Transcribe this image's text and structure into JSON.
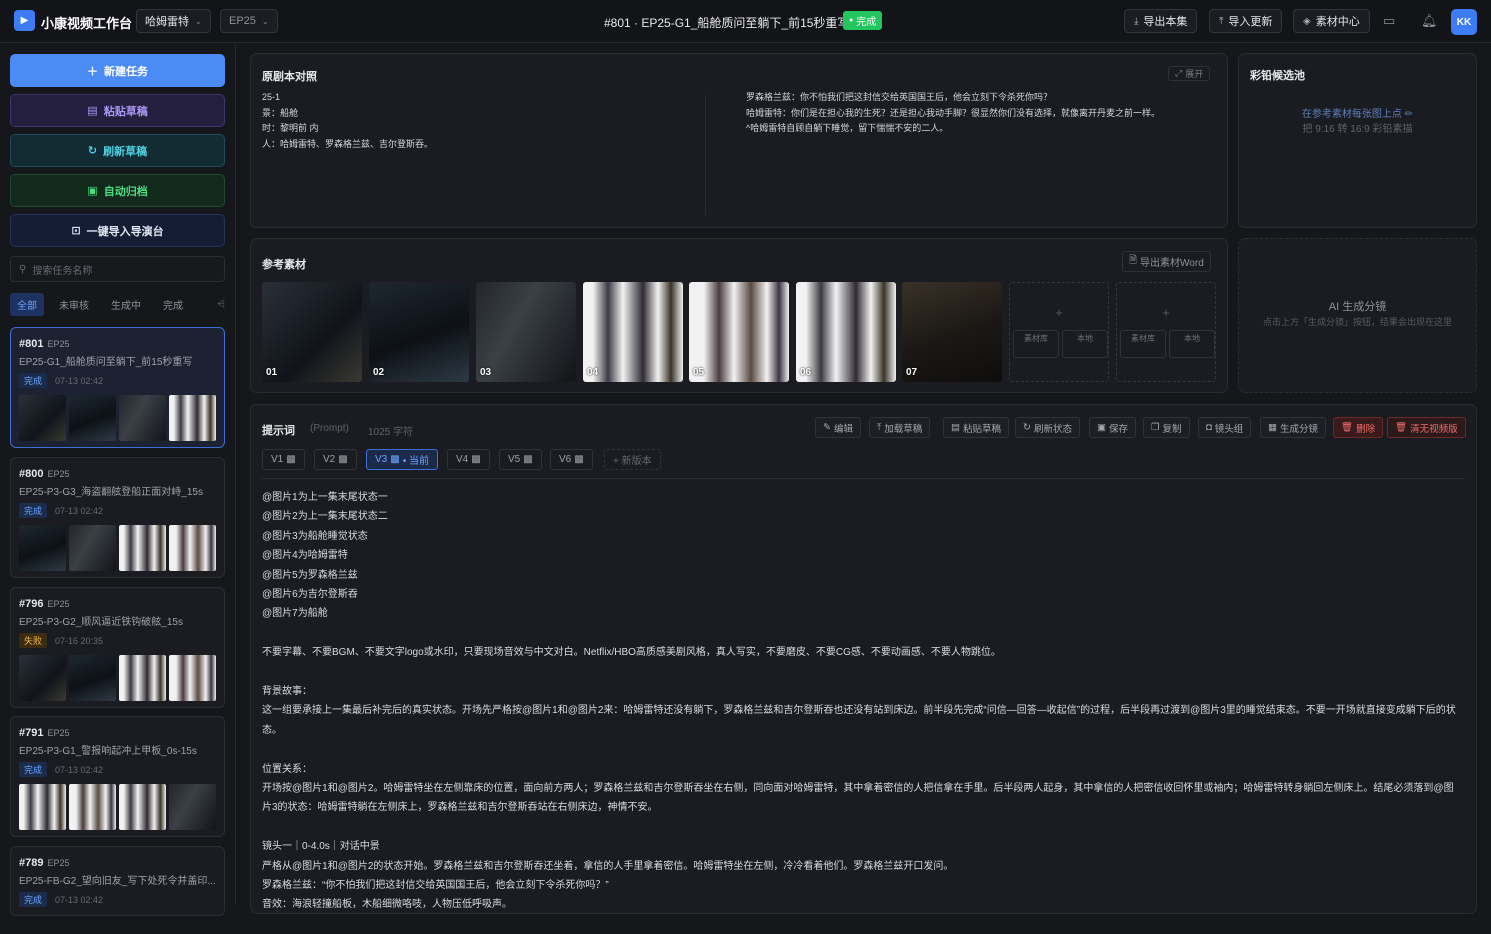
{
  "header": {
    "app_title": "小康视频工作台",
    "project_select": "哈姆雷特",
    "episode_select": "EP25",
    "task_title": "#801 · EP25-G1_船舱质问至躺下_前15秒重写",
    "status_badge": "完成",
    "export_label": "导出本集",
    "import_update_label": "导入更新",
    "materials_label": "素材中心",
    "avatar_initials": "KK"
  },
  "sidebar": {
    "buttons": {
      "new_task": "新建任务",
      "paste_draft": "粘贴草稿",
      "refresh_draft": "刷新草稿",
      "auto_archive": "自动归档",
      "import_director": "一键导入导演台"
    },
    "search_placeholder": "搜索任务名称",
    "filters": [
      "全部",
      "未审核",
      "生成中",
      "完成"
    ],
    "tasks": [
      {
        "id": "#801",
        "ep": "EP25",
        "title": "EP25-G1_船舱质问至躺下_前15秒重写",
        "status": "完成",
        "time": "07-13 02:42"
      },
      {
        "id": "#800",
        "ep": "EP25",
        "title": "EP25-P3-G3_海盗翻舷登船正面对峙_15s",
        "status": "完成",
        "time": "07-13 02:42"
      },
      {
        "id": "#796",
        "ep": "EP25",
        "title": "EP25-P3-G2_顺风逼近铁钩破舷_15s",
        "status": "失败",
        "time": "07-16 20:35"
      },
      {
        "id": "#791",
        "ep": "EP25",
        "title": "EP25-P3-G1_警报响起冲上甲板_0s-15s",
        "status": "完成",
        "time": "07-13 02:42"
      },
      {
        "id": "#789",
        "ep": "EP25",
        "title": "EP25-FB-G2_望向旧友_写下处死令并盖印...",
        "status": "完成",
        "time": "07-13 02:42"
      }
    ]
  },
  "script_panel": {
    "title": "原剧本对照",
    "expand_label": "展开",
    "left_lines": [
      "25-1",
      "景：船舱",
      "时：黎明前 内",
      "人：哈姆雷特、罗森格兰兹、吉尔登斯吞。"
    ],
    "right_lines": [
      "罗森格兰兹：你不怕我们把这封信交给英国国王后，他会立刻下令杀死你吗？",
      "哈姆雷特：你们是在担心我的生死？还是担心我动手脚？很显然你们没有选择，就像离开丹麦之前一样。",
      "^哈姆雷特自顾自躺下睡觉，留下惴惴不安的二人。"
    ]
  },
  "pencil_panel": {
    "title": "彩铅候选池",
    "hint_1": "在参考素材每张图上点 ✏",
    "hint_2": "把 9:16 转 16:9 彩铅素描"
  },
  "reference_panel": {
    "title": "参考素材",
    "export_word_label": "导出素材Word",
    "images": [
      "01",
      "02",
      "03",
      "04",
      "05",
      "06",
      "07"
    ],
    "empty_slot_labels": [
      "素材库",
      "本地"
    ]
  },
  "storyboard_panel": {
    "title": "AI 生成分镜",
    "hint": "点击上方「生成分镜」按钮，结果会出现在这里"
  },
  "prompt_panel": {
    "title": "提示词",
    "subtitle": "(Prompt)",
    "char_count": "1025 字符",
    "toolbar": [
      "编辑",
      "加载草稿",
      "粘贴草稿",
      "刷新状态",
      "保存",
      "复制",
      "镜头组",
      "生成分镜",
      "删除",
      "清无视频版"
    ],
    "versions": [
      "V1",
      "V2",
      "V3",
      "V4",
      "V5",
      "V6"
    ],
    "current_suffix": "• 当前",
    "new_version_label": "+ 新版本",
    "lines": [
      "@图片1为上一集末尾状态一",
      "@图片2为上一集末尾状态二",
      "@图片3为船舱睡觉状态",
      "@图片4为哈姆雷特",
      "@图片5为罗森格兰兹",
      "@图片6为吉尔登斯吞",
      "@图片7为船舱",
      "",
      "不要字幕、不要BGM、不要文字logo或水印，只要现场音效与中文对白。Netflix/HBO高质感美剧风格，真人写实，不要磨皮、不要CG感、不要动画感、不要人物跳位。",
      "",
      "背景故事：",
      "这一组要承接上一集最后补完后的真实状态。开场先严格按@图片1和@图片2来：哈姆雷特还没有躺下，罗森格兰兹和吉尔登斯吞也还没有站到床边。前半段先完成“问信—回答—收起信”的过程，后半段再过渡到@图片3里的睡觉结束态。不要一开场就直接变成躺下后的状态。",
      "",
      "位置关系：",
      "开场按@图片1和@图片2。哈姆雷特坐在左侧靠床的位置，面向前方两人；罗森格兰兹和吉尔登斯吞坐在右侧，同向面对哈姆雷特，其中拿着密信的人把信拿在手里。后半段两人起身，其中拿信的人把密信收回怀里或袖内；哈姆雷特转身躺回左侧床上。结尾必须落到@图片3的状态：哈姆雷特躺在左侧床上，罗森格兰兹和吉尔登斯吞站在右侧床边，神情不安。",
      "",
      "镜头一｜0-4.0s｜对话中景",
      "严格从@图片1和@图片2的状态开始。罗森格兰兹和吉尔登斯吞还坐着，拿信的人手里拿着密信。哈姆雷特坐在左侧，冷冷看着他们。罗森格兰兹开口发问。",
      "罗森格兰兹：“你不怕我们把这封信交给英国国王后，他会立刻下令杀死你吗？”",
      "音效：海浪轻撞船板，木船细微咯吱，人物压低呼吸声。"
    ]
  }
}
